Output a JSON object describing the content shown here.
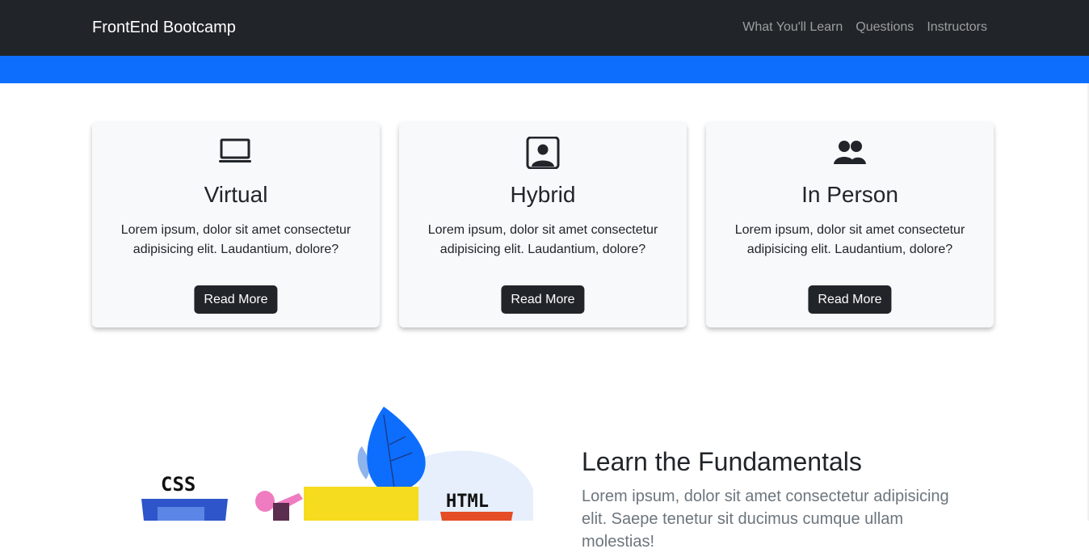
{
  "navbar": {
    "brand": "FrontEnd Bootcamp",
    "links": [
      "What You'll Learn",
      "Questions",
      "Instructors"
    ]
  },
  "cards": [
    {
      "icon": "laptop-icon",
      "title": "Virtual",
      "text": "Lorem ipsum, dolor sit amet consectetur adipisicing elit. Laudantium, dolore?",
      "button": "Read More"
    },
    {
      "icon": "person-badge-icon",
      "title": "Hybrid",
      "text": "Lorem ipsum, dolor sit amet consectetur adipisicing elit. Laudantium, dolore?",
      "button": "Read More"
    },
    {
      "icon": "people-icon",
      "title": "In Person",
      "text": "Lorem ipsum, dolor sit amet consectetur adipisicing elit. Laudantium, dolore?",
      "button": "Read More"
    }
  ],
  "illustration": {
    "labels": [
      "CSS",
      "HTML"
    ]
  },
  "learn": {
    "title": "Learn the Fundamentals",
    "text": "Lorem ipsum, dolor sit amet consectetur adipisicing elit. Saepe tenetur sit ducimus cumque ullam molestias!"
  },
  "colors": {
    "navbar": "#212529",
    "accent": "#0d6efd",
    "card": "#f8f9fa"
  }
}
